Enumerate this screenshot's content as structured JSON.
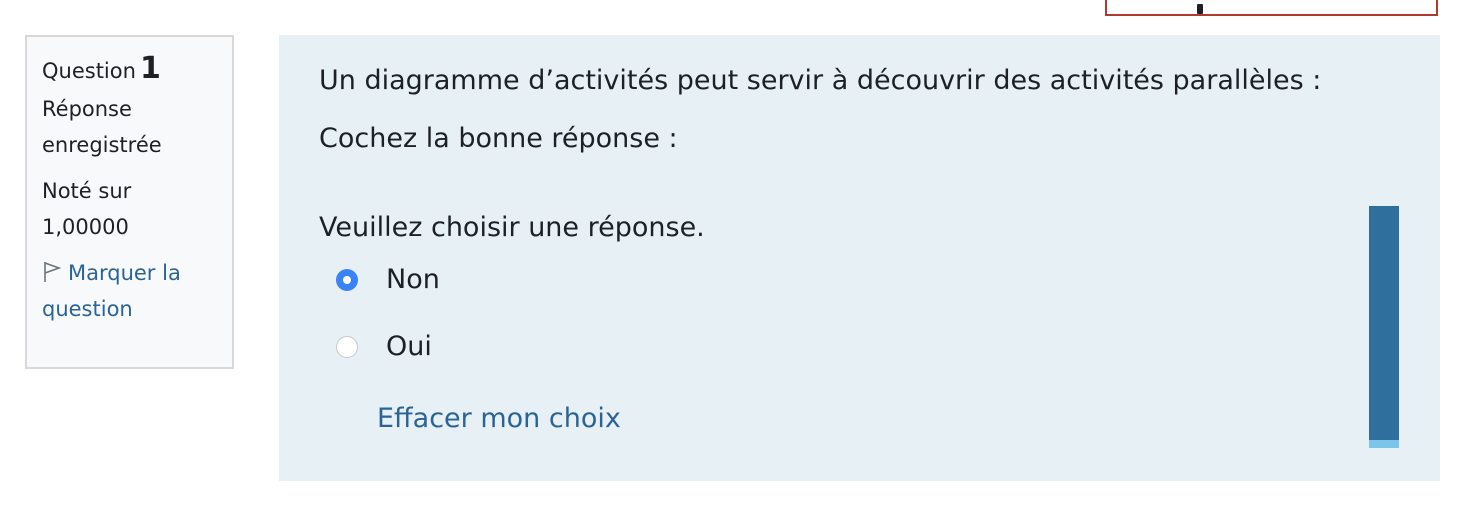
{
  "question_info": {
    "label": "Question",
    "number": "1",
    "status_line1": "Réponse",
    "status_line2": "enregistrée",
    "grade_line1": "Noté sur",
    "grade_line2": "1,00000",
    "flag_line1": "Marquer la",
    "flag_line2": "question"
  },
  "question": {
    "text": "Un diagramme d’activités peut servir à découvrir des activités parallèles :",
    "instruction": "Cochez la bonne réponse :",
    "prompt": "Veuillez choisir une réponse.",
    "options": [
      {
        "label": "Non",
        "checked": true
      },
      {
        "label": "Oui",
        "checked": false
      }
    ],
    "clear_label": "Effacer mon choix"
  },
  "colors": {
    "link": "#2a6496",
    "radio_checked": "#3b82f6",
    "content_bg": "#e7f1f5",
    "scroll_bar": "#2e6f9e",
    "top_box_border": "#b03a2e"
  },
  "icons": {
    "flag": "flag-icon"
  }
}
